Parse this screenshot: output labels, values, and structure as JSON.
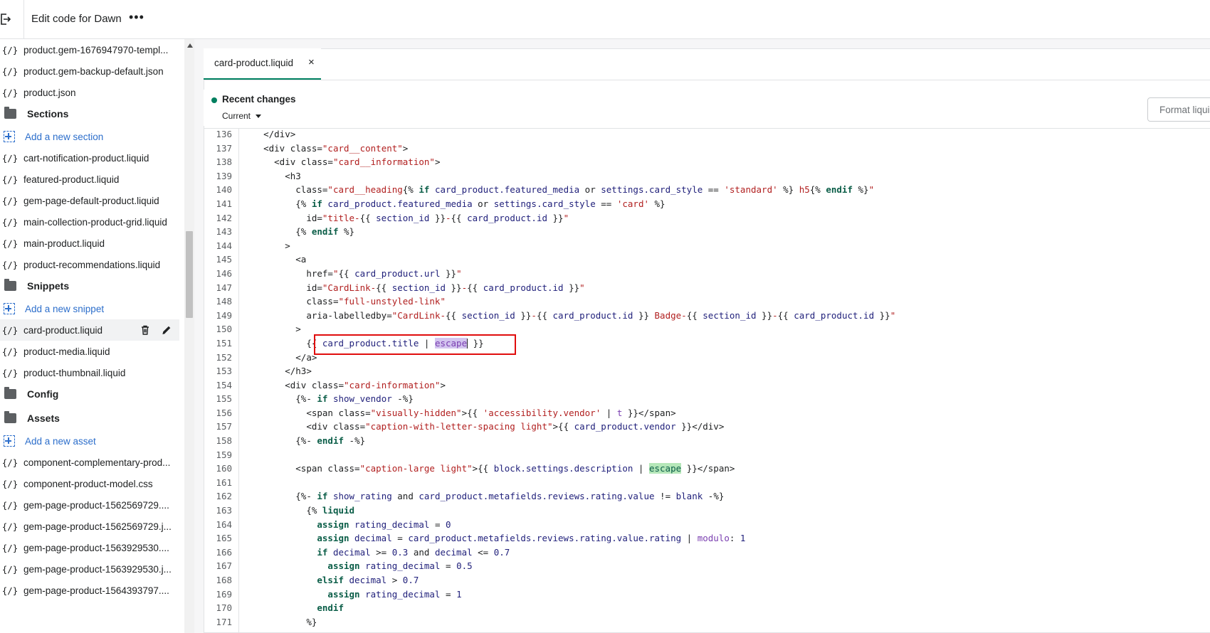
{
  "header": {
    "title": "Edit code for Dawn",
    "more_label": "•••"
  },
  "sidebar": {
    "items": [
      {
        "type": "file",
        "label": "product.gem-1676947970-templ..."
      },
      {
        "type": "file",
        "label": "product.gem-backup-default.json"
      },
      {
        "type": "file",
        "label": "product.json"
      },
      {
        "type": "folder",
        "label": "Sections"
      },
      {
        "type": "add",
        "label": "Add a new section"
      },
      {
        "type": "file",
        "label": "cart-notification-product.liquid"
      },
      {
        "type": "file",
        "label": "featured-product.liquid"
      },
      {
        "type": "file",
        "label": "gem-page-default-product.liquid"
      },
      {
        "type": "file",
        "label": "main-collection-product-grid.liquid"
      },
      {
        "type": "file",
        "label": "main-product.liquid"
      },
      {
        "type": "file",
        "label": "product-recommendations.liquid"
      },
      {
        "type": "folder",
        "label": "Snippets"
      },
      {
        "type": "add",
        "label": "Add a new snippet"
      },
      {
        "type": "file",
        "label": "card-product.liquid",
        "selected": true
      },
      {
        "type": "file",
        "label": "product-media.liquid"
      },
      {
        "type": "file",
        "label": "product-thumbnail.liquid"
      },
      {
        "type": "folder",
        "label": "Config"
      },
      {
        "type": "folder",
        "label": "Assets"
      },
      {
        "type": "add",
        "label": "Add a new asset"
      },
      {
        "type": "file",
        "label": "component-complementary-prod..."
      },
      {
        "type": "file",
        "label": "component-product-model.css"
      },
      {
        "type": "file",
        "label": "gem-page-product-1562569729...."
      },
      {
        "type": "file",
        "label": "gem-page-product-1562569729.j..."
      },
      {
        "type": "file",
        "label": "gem-page-product-1563929530...."
      },
      {
        "type": "file",
        "label": "gem-page-product-1563929530.j..."
      },
      {
        "type": "file",
        "label": "gem-page-product-1564393797...."
      }
    ],
    "file_icon": "{/}"
  },
  "editor": {
    "tab_label": "card-product.liquid",
    "tab_close": "×",
    "recent_changes": "Recent changes",
    "current_label": "Current",
    "format_button": "Format liquid",
    "highlighted_line": 151,
    "lines": [
      {
        "n": "136",
        "html": "<span class=\"t\">&lt;/div&gt;</span>",
        "indent": "    "
      },
      {
        "n": "137",
        "html": "<span class=\"t\">&lt;div class=</span><span class=\"s\">\"card__content\"</span><span class=\"t\">&gt;</span>",
        "indent": "    "
      },
      {
        "n": "138",
        "html": "<span class=\"t\">&lt;div class=</span><span class=\"s\">\"card__information\"</span><span class=\"t\">&gt;</span>",
        "indent": "      "
      },
      {
        "n": "139",
        "html": "<span class=\"t\">&lt;h3</span>",
        "indent": "        "
      },
      {
        "n": "140",
        "html": "<span class=\"t\">class=</span><span class=\"s\">\"card__heading</span><span class=\"t\">{% </span><span class=\"k\">if</span><span class=\"v\"> card_product.featured_media </span><span class=\"t\">or</span><span class=\"v\"> settings.card_style </span><span class=\"t\">== </span><span class=\"s\">'standard'</span><span class=\"t\"> %}</span><span class=\"s\"> h5</span><span class=\"t\">{% </span><span class=\"k\">endif</span><span class=\"t\"> %}</span><span class=\"s\">\"</span>",
        "indent": "          "
      },
      {
        "n": "141",
        "html": "<span class=\"t\">{% </span><span class=\"k\">if</span><span class=\"v\"> card_product.featured_media </span><span class=\"t\">or</span><span class=\"v\"> settings.card_style </span><span class=\"t\">== </span><span class=\"s\">'card'</span><span class=\"t\"> %}</span>",
        "indent": "          "
      },
      {
        "n": "142",
        "html": "<span class=\"t\">id=</span><span class=\"s\">\"title-</span><span class=\"t\">{{ </span><span class=\"v\">section_id</span><span class=\"t\"> }}</span><span class=\"s\">-</span><span class=\"t\">{{ </span><span class=\"v\">card_product.id</span><span class=\"t\"> }}</span><span class=\"s\">\"</span>",
        "indent": "            "
      },
      {
        "n": "143",
        "html": "<span class=\"t\">{% </span><span class=\"k\">endif</span><span class=\"t\"> %}</span>",
        "indent": "          "
      },
      {
        "n": "144",
        "html": "<span class=\"t\">&gt;</span>",
        "indent": "        "
      },
      {
        "n": "145",
        "html": "<span class=\"t\">&lt;a</span>",
        "indent": "          "
      },
      {
        "n": "146",
        "html": "<span class=\"t\">href=</span><span class=\"s\">\"</span><span class=\"t\">{{ </span><span class=\"v\">card_product.url</span><span class=\"t\"> }}</span><span class=\"s\">\"</span>",
        "indent": "            "
      },
      {
        "n": "147",
        "html": "<span class=\"t\">id=</span><span class=\"s\">\"CardLink-</span><span class=\"t\">{{ </span><span class=\"v\">section_id</span><span class=\"t\"> }}</span><span class=\"s\">-</span><span class=\"t\">{{ </span><span class=\"v\">card_product.id</span><span class=\"t\"> }}</span><span class=\"s\">\"</span>",
        "indent": "            "
      },
      {
        "n": "148",
        "html": "<span class=\"t\">class=</span><span class=\"s\">\"full-unstyled-link\"</span>",
        "indent": "            "
      },
      {
        "n": "149",
        "html": "<span class=\"t\">aria-labelledby=</span><span class=\"s\">\"CardLink-</span><span class=\"t\">{{ </span><span class=\"v\">section_id</span><span class=\"t\"> }}</span><span class=\"s\">-</span><span class=\"t\">{{ </span><span class=\"v\">card_product.id</span><span class=\"t\"> }}</span><span class=\"s\"> Badge-</span><span class=\"t\">{{ </span><span class=\"v\">section_id</span><span class=\"t\"> }}</span><span class=\"s\">-</span><span class=\"t\">{{ </span><span class=\"v\">card_product.id</span><span class=\"t\"> }}</span><span class=\"s\">\"</span>",
        "indent": "            "
      },
      {
        "n": "150",
        "html": "<span class=\"t\">&gt;</span>",
        "indent": "          "
      },
      {
        "n": "151",
        "html": "<span class=\"t\">{{ </span><span class=\"v\">card_product.title</span><span class=\"t\"> | </span><span class=\"hl-purple\">escape</span><span class=\"cursor\"></span><span class=\"t\"> }}</span>",
        "indent": "            "
      },
      {
        "n": "152",
        "html": "<span class=\"t\">&lt;/a&gt;</span>",
        "indent": "          "
      },
      {
        "n": "153",
        "html": "<span class=\"t\">&lt;/h3&gt;</span>",
        "indent": "        "
      },
      {
        "n": "154",
        "html": "<span class=\"t\">&lt;div class=</span><span class=\"s\">\"card-information\"</span><span class=\"t\">&gt;</span>",
        "indent": "        "
      },
      {
        "n": "155",
        "html": "<span class=\"t\">{%- </span><span class=\"k\">if</span><span class=\"v\"> show_vendor </span><span class=\"t\">-%}</span>",
        "indent": "          "
      },
      {
        "n": "156",
        "html": "<span class=\"t\">&lt;span class=</span><span class=\"s\">\"visually-hidden\"</span><span class=\"t\">&gt;{{ </span><span class=\"s\">'accessibility.vendor'</span><span class=\"t\"> | </span><span class=\"f\">t</span><span class=\"t\"> }}&lt;/span&gt;</span>",
        "indent": "            "
      },
      {
        "n": "157",
        "html": "<span class=\"t\">&lt;div class=</span><span class=\"s\">\"caption-with-letter-spacing light\"</span><span class=\"t\">&gt;{{ </span><span class=\"v\">card_product.vendor</span><span class=\"t\"> }}&lt;/div&gt;</span>",
        "indent": "            "
      },
      {
        "n": "158",
        "html": "<span class=\"t\">{%- </span><span class=\"k\">endif</span><span class=\"t\"> -%}</span>",
        "indent": "          "
      },
      {
        "n": "159",
        "html": "",
        "indent": ""
      },
      {
        "n": "160",
        "html": "<span class=\"t\">&lt;span class=</span><span class=\"s\">\"caption-large light\"</span><span class=\"t\">&gt;{{ </span><span class=\"v\">block.settings.description</span><span class=\"t\"> | </span><span class=\"hl-green\">escape</span><span class=\"t\"> }}&lt;/span&gt;</span>",
        "indent": "          "
      },
      {
        "n": "161",
        "html": "",
        "indent": ""
      },
      {
        "n": "162",
        "html": "<span class=\"t\">{%- </span><span class=\"k\">if</span><span class=\"v\"> show_rating </span><span class=\"t\">and</span><span class=\"v\"> card_product.metafields.reviews.rating.value </span><span class=\"t\">!= </span><span class=\"v\">blank</span><span class=\"t\"> -%}</span>",
        "indent": "          "
      },
      {
        "n": "163",
        "html": "<span class=\"t\">{% </span><span class=\"k\">liquid</span>",
        "indent": "            "
      },
      {
        "n": "164",
        "html": "<span class=\"k\">assign</span><span class=\"v\"> rating_decimal </span><span class=\"t\">= </span><span class=\"v\">0</span>",
        "indent": "              "
      },
      {
        "n": "165",
        "html": "<span class=\"k\">assign</span><span class=\"v\"> decimal </span><span class=\"t\">= </span><span class=\"v\">card_product.metafields.reviews.rating.value.rating</span><span class=\"t\"> | </span><span class=\"f\">modulo</span><span class=\"t\">: </span><span class=\"v\">1</span>",
        "indent": "              "
      },
      {
        "n": "166",
        "html": "<span class=\"k\">if</span><span class=\"v\"> decimal </span><span class=\"t\">&gt;= </span><span class=\"v\">0.3 </span><span class=\"t\">and</span><span class=\"v\"> decimal </span><span class=\"t\">&lt;= </span><span class=\"v\">0.7</span>",
        "indent": "              "
      },
      {
        "n": "167",
        "html": "<span class=\"k\">assign</span><span class=\"v\"> rating_decimal </span><span class=\"t\">= </span><span class=\"v\">0.5</span>",
        "indent": "                "
      },
      {
        "n": "168",
        "html": "<span class=\"k\">elsif</span><span class=\"v\"> decimal </span><span class=\"t\">&gt; </span><span class=\"v\">0.7</span>",
        "indent": "              "
      },
      {
        "n": "169",
        "html": "<span class=\"k\">assign</span><span class=\"v\"> rating_decimal </span><span class=\"t\">= </span><span class=\"v\">1</span>",
        "indent": "                "
      },
      {
        "n": "170",
        "html": "<span class=\"k\">endif</span>",
        "indent": "              "
      },
      {
        "n": "171",
        "html": "<span class=\"t\">%}</span>",
        "indent": "            "
      }
    ]
  },
  "colors": {
    "accent": "#008060",
    "link": "#2c6ecb",
    "highlight_box": "#e00d0d"
  }
}
